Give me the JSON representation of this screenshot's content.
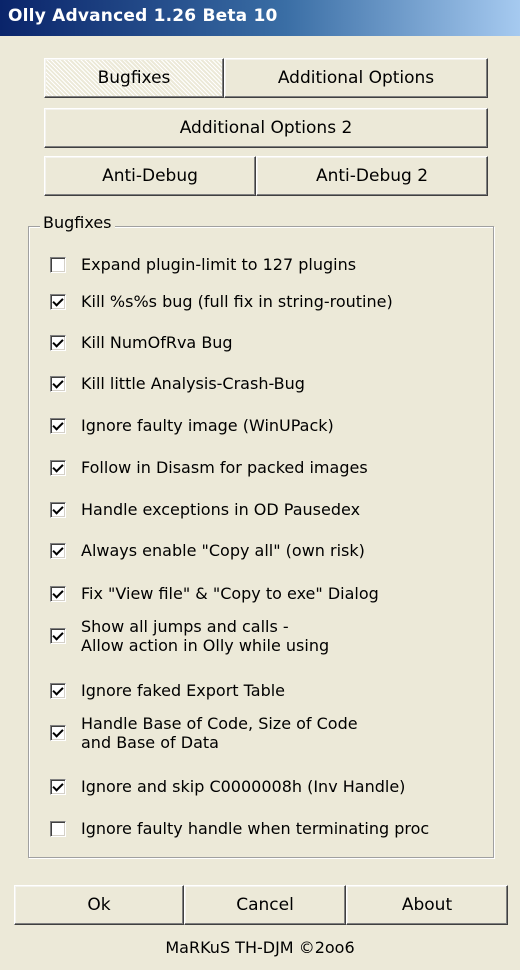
{
  "window": {
    "title": "Olly Advanced 1.26 Beta 10"
  },
  "tabs": {
    "bugfixes": "Bugfixes",
    "additional_options": "Additional Options",
    "additional_options_2": "Additional Options 2",
    "anti_debug": "Anti-Debug",
    "anti_debug_2": "Anti-Debug 2",
    "active": "Bugfixes"
  },
  "group": {
    "title": "Bugfixes",
    "options": [
      {
        "label": "Expand plugin-limit to 127 plugins",
        "checked": false
      },
      {
        "label": "Kill %s%s bug (full fix in string-routine)",
        "checked": true
      },
      {
        "label": "Kill NumOfRva Bug",
        "checked": true
      },
      {
        "label": "Kill little Analysis-Crash-Bug",
        "checked": true
      },
      {
        "label": "Ignore faulty image (WinUPack)",
        "checked": true
      },
      {
        "label": "Follow in Disasm for packed images",
        "checked": true
      },
      {
        "label": "Handle exceptions in OD Pausedex",
        "checked": true
      },
      {
        "label": "Always enable \"Copy all\" (own risk)",
        "checked": true
      },
      {
        "label": "Fix \"View file\" & \"Copy to exe\" Dialog",
        "checked": true
      },
      {
        "label_line1": "Show all jumps and calls -",
        "label_line2": "Allow action in Olly while using",
        "checked": true
      },
      {
        "label": "Ignore faked Export Table",
        "checked": true
      },
      {
        "label_line1": "Handle Base of Code, Size of Code",
        "label_line2": "and Base of Data",
        "checked": true
      },
      {
        "label": "Ignore and skip C0000008h (Inv Handle)",
        "checked": true
      },
      {
        "label": "Ignore faulty handle when terminating proc",
        "checked": false
      }
    ]
  },
  "buttons": {
    "ok": "Ok",
    "cancel": "Cancel",
    "about": "About"
  },
  "footer": {
    "credit": "MaRKuS TH-DJM ©2oo6"
  }
}
